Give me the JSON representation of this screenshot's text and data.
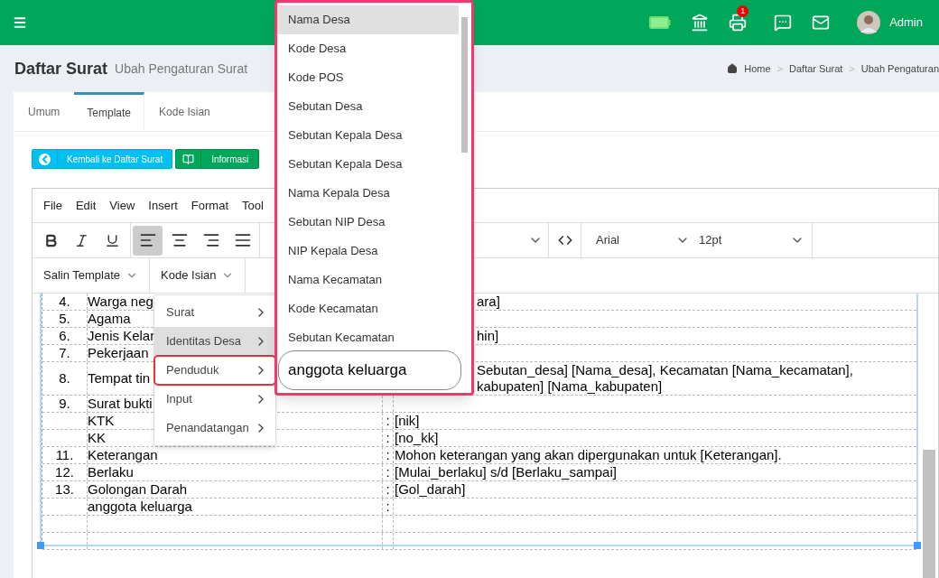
{
  "header": {
    "user": "Admin",
    "notification_count": "1"
  },
  "page": {
    "title": "Daftar Surat",
    "subtitle": "Ubah Pengaturan Surat"
  },
  "breadcrumb": [
    {
      "label": "Home"
    },
    {
      "separator": ">",
      "label": "Daftar Surat"
    },
    {
      "separator": ">",
      "label": "Ubah Pengaturan"
    }
  ],
  "tabs": [
    {
      "label": "Umum",
      "selected": false
    },
    {
      "label": "Template",
      "selected": true
    },
    {
      "label": "Kode Isian",
      "selected": false
    }
  ],
  "buttons": [
    {
      "label": "Kembali ke Daftar Surat",
      "kind": "back"
    },
    {
      "label": "Informasi",
      "kind": "info"
    }
  ],
  "editor": {
    "menu": [
      "File",
      "Edit",
      "View",
      "Insert",
      "Format",
      "Tool"
    ],
    "format_buttons": [
      {
        "kind": "bold",
        "selected": false
      },
      {
        "kind": "italic",
        "selected": false
      },
      {
        "kind": "underline",
        "selected": false
      },
      {
        "kind": "align-left",
        "selected": true
      },
      {
        "kind": "align-center",
        "selected": false
      },
      {
        "kind": "align-right",
        "selected": false
      },
      {
        "kind": "align-justify",
        "selected": false
      }
    ],
    "font": "Arial",
    "size": "12pt",
    "custom_menus": [
      "Salin Template",
      "Kode Isian"
    ],
    "rows": [
      {
        "num": "4.",
        "label": "Warga neg",
        "value": [
          "ara]"
        ],
        "clipped": true
      },
      {
        "num": "5.",
        "label": "Agama"
      },
      {
        "num": "6.",
        "label": "Jenis Kelar",
        "value": [
          "hin]"
        ],
        "clipped": true
      },
      {
        "num": "7.",
        "label": "Pekerjaan"
      },
      {
        "num": "8.",
        "label": "Tempat tin",
        "value": [
          "Sebutan_desa] [Nama_desa], Kecamatan [Nama_kecamatan],",
          "kabupaten] [Nama_kabupaten]"
        ],
        "clipped": true
      },
      {
        "num": "9.",
        "label": "Surat bukti"
      },
      {
        "label": "KTK",
        "sep": ":",
        "value": [
          "[nik]"
        ]
      },
      {
        "label": "KK",
        "sep": ":",
        "value": [
          "[no_kk]"
        ]
      },
      {
        "num": "11.",
        "label": "Keterangan",
        "sep": ":",
        "value": [
          "Mohon keterangan yang akan dipergunakan untuk [Keterangan]."
        ]
      },
      {
        "num": "12.",
        "label": "Berlaku",
        "sep": ":",
        "value": [
          "[Mulai_berlaku] s/d [Berlaku_sampai]"
        ]
      },
      {
        "num": "13.",
        "label": "Golongan Darah",
        "sep": ":",
        "value": [
          "[Gol_darah]"
        ]
      },
      {
        "label": "anggota keluarga",
        "sep": ":"
      },
      {},
      {}
    ]
  },
  "submenu": [
    {
      "label": "Surat",
      "selected": false,
      "marked": false
    },
    {
      "label": "Identitas Desa",
      "selected": true,
      "marked": false
    },
    {
      "label": "Penduduk",
      "selected": false,
      "marked": true
    },
    {
      "label": "Input",
      "selected": false,
      "marked": false
    },
    {
      "label": "Penandatangan",
      "selected": false,
      "marked": false
    }
  ],
  "dropdown": {
    "items": [
      {
        "label": "Nama Desa",
        "selected": true
      },
      {
        "label": "Kode Desa",
        "selected": false
      },
      {
        "label": "Kode POS",
        "selected": false
      },
      {
        "label": "Sebutan Desa",
        "selected": false
      },
      {
        "label": "Sebutan Kepala Desa",
        "selected": false
      },
      {
        "label": "Sebutan Kepala Desa",
        "selected": false
      },
      {
        "label": "Nama Kepala Desa",
        "selected": false
      },
      {
        "label": "Sebutan NIP Desa",
        "selected": false
      },
      {
        "label": "NIP Kepala Desa",
        "selected": false
      },
      {
        "label": "Nama Kecamatan",
        "selected": false
      },
      {
        "label": "Kode Kecamatan",
        "selected": false
      },
      {
        "label": "Sebutan Kecamatan",
        "selected": false
      }
    ],
    "search_value": "anggota keluarga"
  }
}
